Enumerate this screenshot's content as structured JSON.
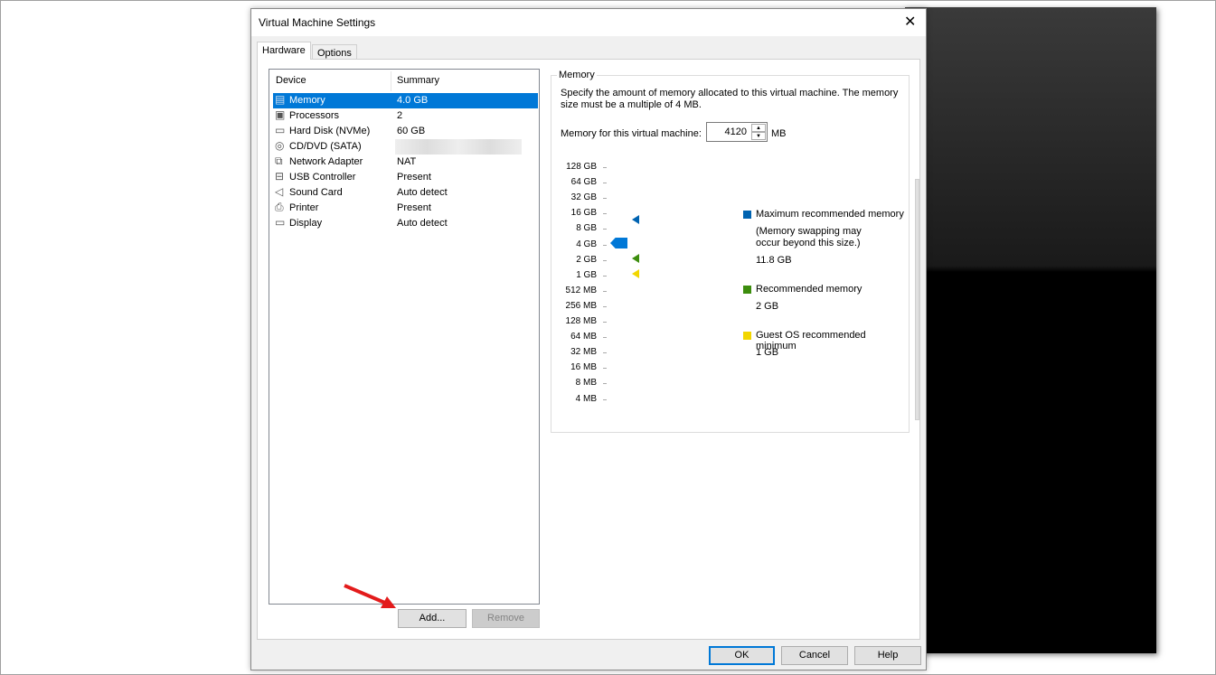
{
  "dialog": {
    "title": "Virtual Machine Settings",
    "tabs": [
      "Hardware",
      "Options"
    ]
  },
  "device_list": {
    "headers": [
      "Device",
      "Summary"
    ],
    "rows": [
      {
        "device": "Memory",
        "summary": "4.0 GB",
        "icon": "memory-icon"
      },
      {
        "device": "Processors",
        "summary": "2",
        "icon": "processor-icon"
      },
      {
        "device": "Hard Disk (NVMe)",
        "summary": "60 GB",
        "icon": "hard-disk-icon"
      },
      {
        "device": "CD/DVD (SATA)",
        "summary": "",
        "icon": "cd-dvd-icon"
      },
      {
        "device": "Network Adapter",
        "summary": "NAT",
        "icon": "network-adapter-icon"
      },
      {
        "device": "USB Controller",
        "summary": "Present",
        "icon": "usb-icon"
      },
      {
        "device": "Sound Card",
        "summary": "Auto detect",
        "icon": "speaker-icon"
      },
      {
        "device": "Printer",
        "summary": "Present",
        "icon": "printer-icon"
      },
      {
        "device": "Display",
        "summary": "Auto detect",
        "icon": "display-icon"
      }
    ]
  },
  "buttons": {
    "add": "Add...",
    "remove": "Remove",
    "ok": "OK",
    "cancel": "Cancel",
    "help": "Help"
  },
  "memory": {
    "group_label": "Memory",
    "description": "Specify the amount of memory allocated to this virtual machine. The memory size must be a multiple of 4 MB.",
    "field_label": "Memory for this virtual machine:",
    "value": "4120",
    "unit": "MB",
    "scale": [
      "128 GB",
      "64 GB",
      "32 GB",
      "16 GB",
      "8 GB",
      "4 GB",
      "2 GB",
      "1 GB",
      "512 MB",
      "256 MB",
      "128 MB",
      "64 MB",
      "32 MB",
      "16 MB",
      "8 MB",
      "4 MB"
    ],
    "slider_value_gb": 4,
    "legend": [
      {
        "title": "Maximum recommended memory",
        "note": "(Memory swapping may occur beyond this size.)",
        "value": "11.8 GB",
        "color": "#0063b1"
      },
      {
        "title": "Recommended memory",
        "value": "2 GB",
        "color": "#3c8d0d"
      },
      {
        "title": "Guest OS recommended minimum",
        "value": "1 GB",
        "color": "#f2d600"
      }
    ]
  }
}
